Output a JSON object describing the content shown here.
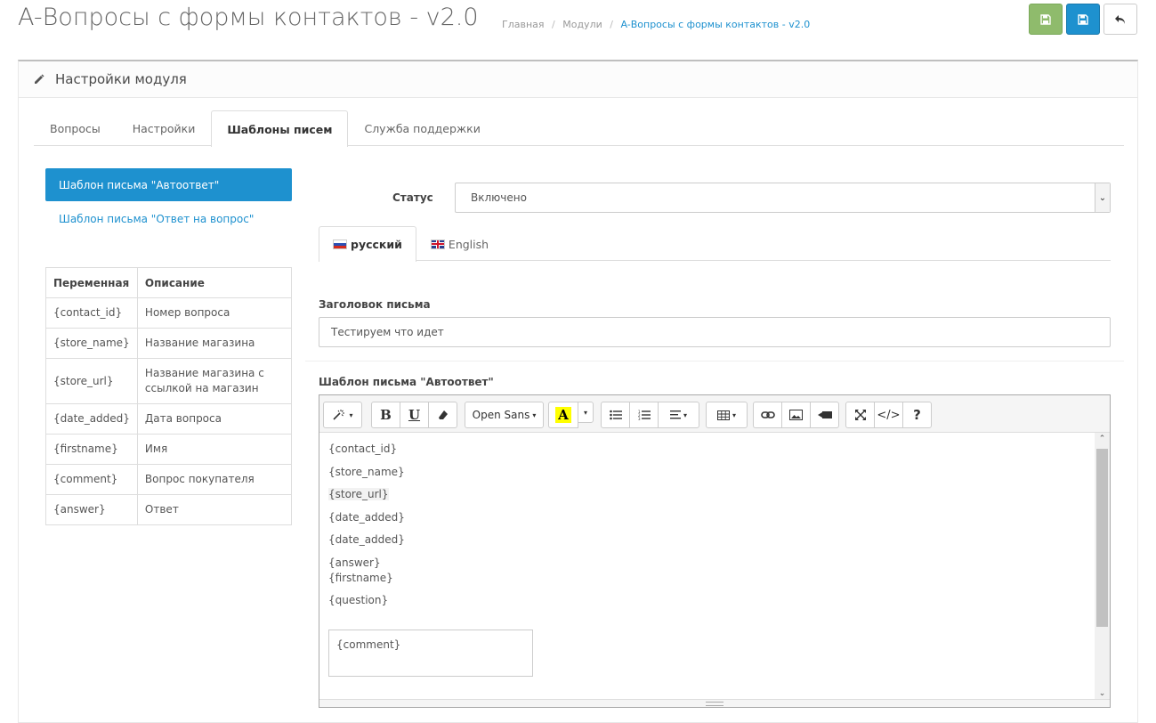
{
  "header": {
    "title": "A-Вопросы с формы контактов - v2.0",
    "breadcrumb": [
      "Главная",
      "Модули",
      "A-Вопросы с формы контактов - v2.0"
    ],
    "icons": {
      "save_stay": "save-icon",
      "save": "save-icon",
      "back": "reply-icon"
    },
    "colors": {
      "success": "#8fbb6c",
      "primary": "#1e91cf"
    }
  },
  "panel": {
    "heading": "Настройки модуля",
    "heading_icon": "pencil-icon",
    "tabs": [
      "Вопросы",
      "Настройки",
      "Шаблоны писем",
      "Служба поддержки"
    ],
    "active_tab": "Шаблоны писем"
  },
  "templates": {
    "active": "Шаблон письма \"Автоответ\"",
    "other": "Шаблон письма \"Ответ на вопрос\""
  },
  "variables": {
    "headers": [
      "Переменная",
      "Описание"
    ],
    "rows": [
      [
        "{contact_id}",
        "Номер вопроса"
      ],
      [
        "{store_name}",
        "Название магазина"
      ],
      [
        "{store_url}",
        "Название магазина с ссылкой на магазин"
      ],
      [
        "{date_added}",
        "Дата вопроса"
      ],
      [
        "{firstname}",
        "Имя"
      ],
      [
        "{comment}",
        "Вопрос покупателя"
      ],
      [
        "{answer}",
        "Ответ"
      ]
    ]
  },
  "form": {
    "status_label": "Статус",
    "status_value": "Включено",
    "languages": [
      "русский",
      "English"
    ],
    "active_language": "русский",
    "subject_label": "Заголовок письма",
    "subject_value": "Тестируем что идет",
    "template_label": "Шаблон письма \"Автоответ\""
  },
  "editor": {
    "font_name": "Open Sans",
    "toolbar_icons": [
      "magic-icon",
      "bold-icon",
      "underline-icon",
      "eraser-icon",
      "font-name-dropdown",
      "font-color-icon",
      "unordered-list-icon",
      "ordered-list-icon",
      "align-icon",
      "table-icon",
      "link-icon",
      "picture-icon",
      "video-icon",
      "fullscreen-icon",
      "code-view-icon",
      "help-icon"
    ],
    "lines": [
      "{contact_id}",
      "{store_name}",
      "{store_url}",
      "{date_added}",
      "{date_added}"
    ],
    "block": [
      "{answer}",
      "{firstname}"
    ],
    "last_line": "{question}",
    "table_cell": "{comment}"
  }
}
